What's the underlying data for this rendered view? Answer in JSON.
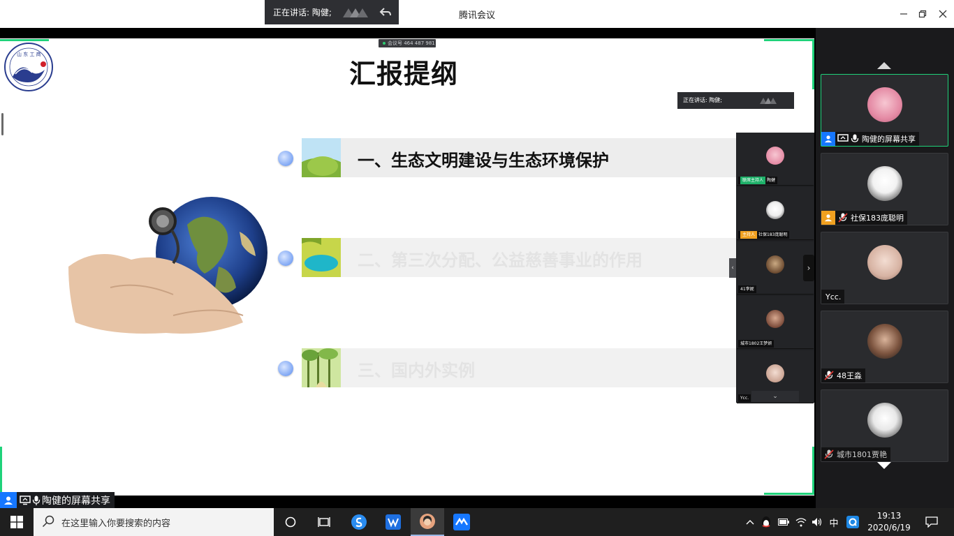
{
  "titlebar": {
    "speaking_label": "正在讲话: 陶健;",
    "app_title": "腾讯会议"
  },
  "slide": {
    "meeting_id": "会议号 464 487 981",
    "title": "汇报提纲",
    "mini_speaking": "正在讲话: 陶健;",
    "outline": [
      {
        "label": "一、生态文明建设与生态环境保护",
        "active": true
      },
      {
        "label": "二、第三次分配、公益慈善事业的作用",
        "active": false
      },
      {
        "label": "三、国内外实例",
        "active": false
      }
    ]
  },
  "mini_strip": {
    "tiles": [
      {
        "role": "联席主持人",
        "name": "陶健",
        "role_color": "#1fb16a"
      },
      {
        "role": "主持人",
        "name": "社保183庞聪明",
        "role_color": "#f0a020"
      },
      {
        "role": "",
        "name": "41李妮"
      },
      {
        "role": "",
        "name": "城市1802王梦妍"
      },
      {
        "role": "",
        "name": "Ycc."
      }
    ]
  },
  "share_label": "陶健的屏幕共享",
  "participants": [
    {
      "name": "陶健的屏幕共享",
      "active": true
    },
    {
      "name": "社保183庞聪明",
      "active": false
    },
    {
      "name": "Ycc.",
      "active": false
    },
    {
      "name": "48王淼",
      "active": false
    },
    {
      "name": "城市1801贾艳",
      "active": false
    }
  ],
  "taskbar": {
    "search_placeholder": "在这里输入你要搜索的内容",
    "ime": "中",
    "time": "19:13",
    "date": "2020/6/19"
  },
  "colors": {
    "accent_green": "#1fd27a",
    "brand_blue": "#1677ff",
    "host_orange": "#f0a020"
  }
}
